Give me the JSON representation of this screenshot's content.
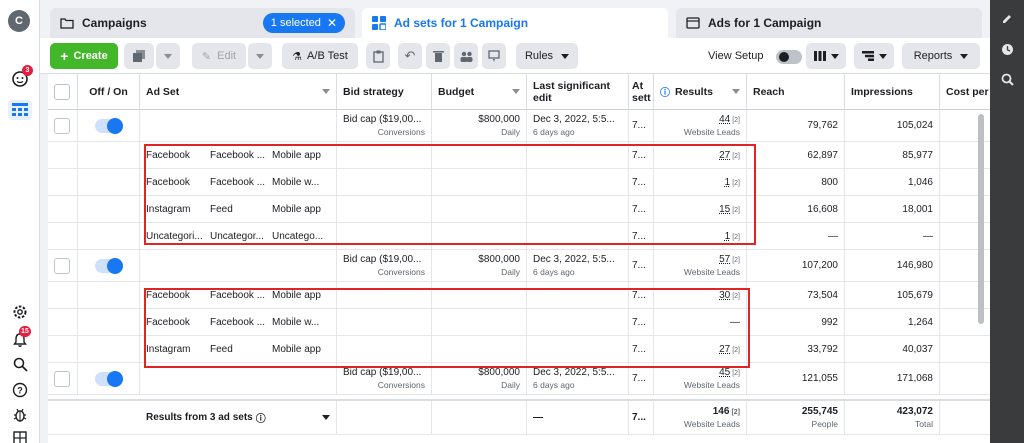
{
  "leftrail": {
    "avatar_letter": "C",
    "notif_badge": "3",
    "alerts_badge": "15"
  },
  "tabs": [
    {
      "label": "Campaigns",
      "selected_pill": "1 selected"
    },
    {
      "label": "Ad sets for 1 Campaign"
    },
    {
      "label": "Ads for 1 Campaign"
    }
  ],
  "toolbar": {
    "create": "Create",
    "edit": "Edit",
    "ab_test": "A/B Test",
    "rules": "Rules",
    "view_setup": "View Setup",
    "reports": "Reports"
  },
  "columns": {
    "off_on": "Off / On",
    "ad_set": "Ad Set",
    "bid_strategy": "Bid strategy",
    "budget": "Budget",
    "last_edit": "Last significant edit",
    "attribution": "At sett",
    "results": "Results",
    "reach": "Reach",
    "impressions": "Impressions",
    "cost_per": "Cost per"
  },
  "rows": [
    {
      "kind": "adset",
      "bid": "Bid cap ($19,00...",
      "bid_sub": "Conversions",
      "budget": "$800,000",
      "budget_sub": "Daily",
      "edit": "Dec 3, 2022, 5:5...",
      "edit_sub": "6 days ago",
      "attr": "7...",
      "results": "44",
      "results_sup": "[2]",
      "results_sub": "Website Leads",
      "reach": "79,762",
      "impressions": "105,024"
    },
    {
      "kind": "breakdown",
      "c1": "Facebook",
      "c2": "Facebook ...",
      "c3": "Mobile app",
      "attr": "7...",
      "results": "27",
      "results_sup": "[2]",
      "reach": "62,897",
      "impressions": "85,977"
    },
    {
      "kind": "breakdown",
      "c1": "Facebook",
      "c2": "Facebook ...",
      "c3": "Mobile w...",
      "attr": "7...",
      "results": "1",
      "results_sup": "[2]",
      "reach": "800",
      "impressions": "1,046"
    },
    {
      "kind": "breakdown",
      "c1": "Instagram",
      "c2": "Feed",
      "c3": "Mobile app",
      "attr": "7...",
      "results": "15",
      "results_sup": "[2]",
      "reach": "16,608",
      "impressions": "18,001"
    },
    {
      "kind": "breakdown",
      "c1": "Uncategori...",
      "c2": "Uncategor...",
      "c3": "Uncatego...",
      "attr": "7...",
      "results": "1",
      "results_sup": "[2]",
      "reach": "—",
      "impressions": "—"
    },
    {
      "kind": "adset",
      "bid": "Bid cap ($19,00...",
      "bid_sub": "Conversions",
      "budget": "$800,000",
      "budget_sub": "Daily",
      "edit": "Dec 3, 2022, 5:5...",
      "edit_sub": "6 days ago",
      "attr": "7...",
      "results": "57",
      "results_sup": "[2]",
      "results_sub": "Website Leads",
      "reach": "107,200",
      "impressions": "146,980"
    },
    {
      "kind": "breakdown",
      "c1": "Facebook",
      "c2": "Facebook ...",
      "c3": "Mobile app",
      "attr": "7...",
      "results": "30",
      "results_sup": "[2]",
      "reach": "73,504",
      "impressions": "105,679"
    },
    {
      "kind": "breakdown",
      "c1": "Facebook",
      "c2": "Facebook ...",
      "c3": "Mobile w...",
      "attr": "7...",
      "results": "—",
      "results_sup": "",
      "reach": "992",
      "impressions": "1,264"
    },
    {
      "kind": "breakdown",
      "c1": "Instagram",
      "c2": "Feed",
      "c3": "Mobile app",
      "attr": "7...",
      "results": "27",
      "results_sup": "[2]",
      "reach": "33,792",
      "impressions": "40,037"
    },
    {
      "kind": "adset",
      "bid": "Bid cap ($19,00...",
      "bid_sub": "Conversions",
      "budget": "$800,000",
      "budget_sub": "Daily",
      "edit": "Dec 3, 2022, 5:5...",
      "edit_sub": "6 days ago",
      "attr": "7...",
      "results": "45",
      "results_sup": "[2]",
      "results_sub": "Website Leads",
      "reach": "121,055",
      "impressions": "171,068"
    }
  ],
  "totals": {
    "label": "Results from 3 ad sets",
    "edit": "—",
    "attr": "7...",
    "results": "146",
    "results_sup": "[2]",
    "results_sub": "Website Leads",
    "reach": "255,745",
    "reach_sub": "People",
    "impressions": "423,072",
    "impressions_sub": "Total"
  },
  "colors": {
    "accent": "#1877f2",
    "create": "#42b72a",
    "highlight": "#e02424"
  }
}
